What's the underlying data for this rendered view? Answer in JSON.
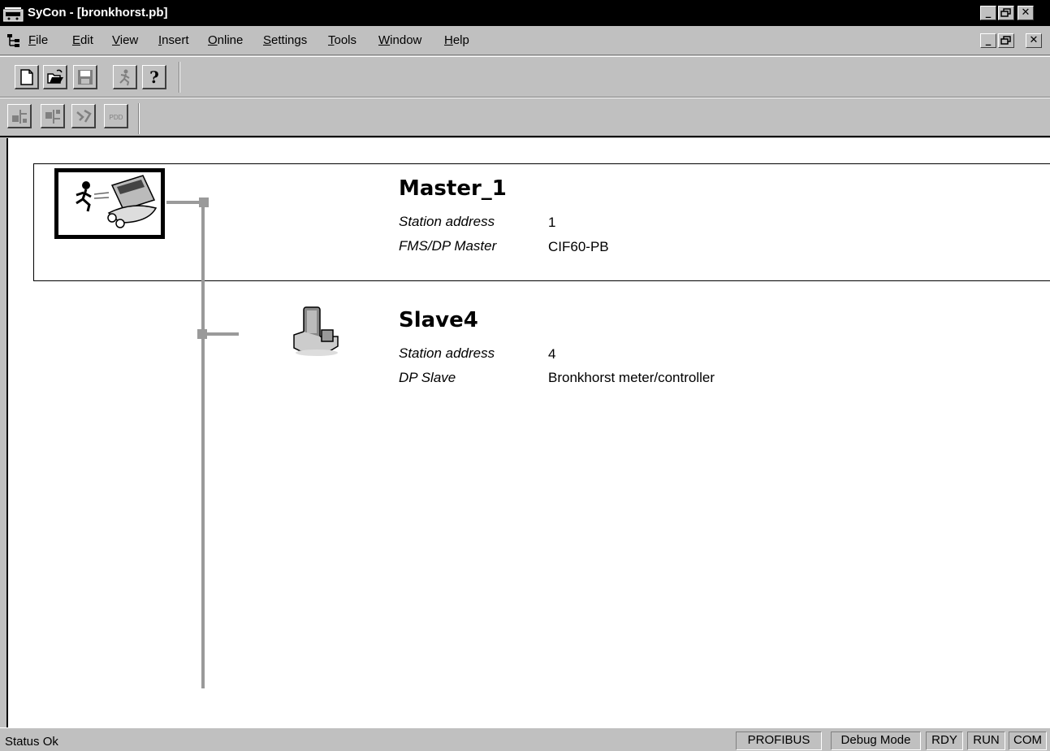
{
  "window": {
    "title": "SyCon - [bronkhorst.pb]",
    "minimize_glyph": "_",
    "restore_glyph": "🗗",
    "close_glyph": "✕"
  },
  "menu": {
    "items": [
      {
        "accel": "F",
        "rest": "ile"
      },
      {
        "accel": "E",
        "rest": "dit"
      },
      {
        "accel": "V",
        "rest": "iew"
      },
      {
        "accel": "I",
        "rest": "nsert"
      },
      {
        "accel": "O",
        "rest": "nline"
      },
      {
        "accel": "S",
        "rest": "ettings"
      },
      {
        "accel": "T",
        "rest": "ools"
      },
      {
        "accel": "W",
        "rest": "indow"
      },
      {
        "accel": "H",
        "rest": "elp"
      }
    ]
  },
  "toolbar": {
    "help_glyph": "?",
    "gsd_label": "PDD"
  },
  "network": {
    "master": {
      "name": "Master_1",
      "address_label": "Station address",
      "address": "1",
      "type_label": "FMS/DP Master",
      "type_value": "CIF60-PB"
    },
    "slave": {
      "name": "Slave4",
      "address_label": "Station address",
      "address": "4",
      "type_label": "DP Slave",
      "type_value": "Bronkhorst meter/controller"
    }
  },
  "statusbar": {
    "status": "Status Ok",
    "panes": [
      "PROFIBUS",
      "Debug Mode",
      "RDY",
      "RUN",
      "COM"
    ]
  },
  "colors": {
    "bus_line": "#9a9a9a",
    "face": "#c0c0c0"
  }
}
